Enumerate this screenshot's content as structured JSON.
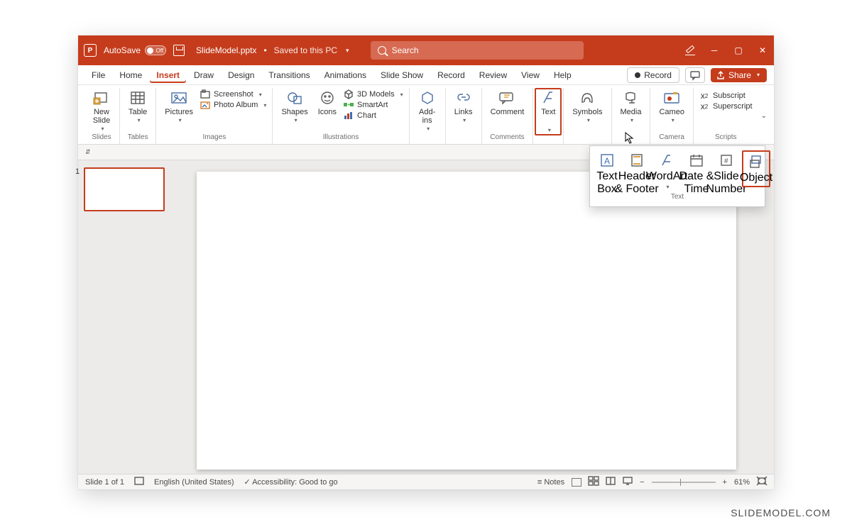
{
  "titlebar": {
    "autosave_label": "AutoSave",
    "autosave_state": "Off",
    "filename": "SlideModel.pptx",
    "saved_to": "Saved to this PC",
    "search_placeholder": "Search"
  },
  "tabs": {
    "file": "File",
    "home": "Home",
    "insert": "Insert",
    "draw": "Draw",
    "design": "Design",
    "transitions": "Transitions",
    "animations": "Animations",
    "slideshow": "Slide Show",
    "record": "Record",
    "review": "Review",
    "view": "View",
    "help": "Help"
  },
  "menuright": {
    "record": "Record",
    "share": "Share"
  },
  "ribbon": {
    "groups": {
      "slides": "Slides",
      "tables": "Tables",
      "images": "Images",
      "illustrations": "Illustrations",
      "comments": "Comments",
      "camera": "Camera",
      "scripts": "Scripts",
      "text": "Text"
    },
    "buttons": {
      "new_slide": "New\nSlide",
      "table": "Table",
      "pictures": "Pictures",
      "screenshot": "Screenshot",
      "photo_album": "Photo Album",
      "shapes": "Shapes",
      "icons": "Icons",
      "models3d": "3D Models",
      "smartart": "SmartArt",
      "chart": "Chart",
      "addins": "Add-\nins",
      "links": "Links",
      "comment": "Comment",
      "text": "Text",
      "symbols": "Symbols",
      "media": "Media",
      "cameo": "Cameo",
      "subscript": "Subscript",
      "superscript": "Superscript",
      "textbox": "Text\nBox",
      "header_footer": "Header\n& Footer",
      "wordart": "WordArt",
      "date_time": "Date &\nTime",
      "slide_number": "Slide\nNumber",
      "object": "Object"
    }
  },
  "thumbnails": {
    "n1": "1"
  },
  "statusbar": {
    "slide": "Slide 1 of 1",
    "lang": "English (United States)",
    "accessibility": "Accessibility: Good to go",
    "notes": "Notes",
    "zoom": "61%"
  },
  "watermark": "SLIDEMODEL.COM"
}
